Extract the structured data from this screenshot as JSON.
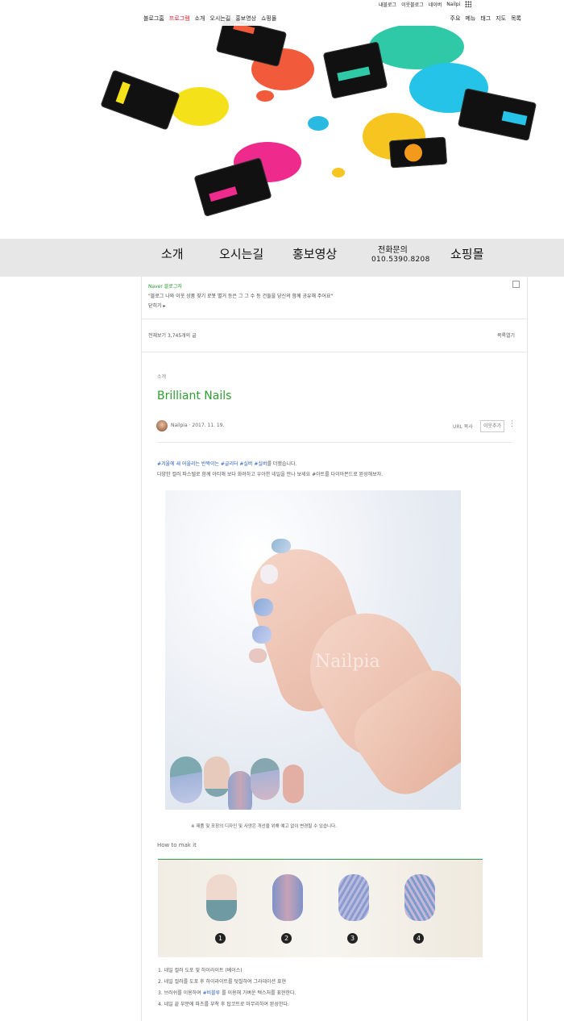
{
  "topnav": {
    "items": [
      "블로그홈",
      "프로그램",
      "소개",
      "오시는길",
      "홍보영상",
      "쇼핑몰"
    ],
    "selected_index": 1,
    "right_items": [
      "주요",
      "메뉴",
      "태그",
      "지도",
      "목록"
    ],
    "top_right": [
      "내블로그",
      "이웃블로그",
      "네이버",
      "Nailpi"
    ]
  },
  "menu": {
    "intro": "소개",
    "directions": "오시는길",
    "promo": "홍보영상",
    "phone_title": "전화문의",
    "phone_number": "010.5390.8208",
    "shop": "쇼핑몰"
  },
  "ad": {
    "brand": "Naver 블로그자",
    "line": "\"블로그 나와 이웃 상품 찾기 로봇 별거 등은 그 그 수 등 건들을 당신의 함께 공유해 주어요\"",
    "link": "닫히기 ▸"
  },
  "list": {
    "header": "전체보기 3,745개의 글",
    "toggle": "목록열기"
  },
  "post": {
    "category": "소개",
    "title": "Brilliant Nails",
    "author": "Nailpia · 2017. 11. 19.",
    "url_copy": "URL 복사",
    "neighbor_btn": "이웃추가",
    "more": "⋮",
    "line1_tags": [
      "#겨울에 새 어울리는 반짝이는 ",
      "#글리터",
      " #실버 ",
      "#실버",
      "를 더했습니다."
    ],
    "line2": "다양한 컬러 파스텔로 함께 아티해 보다 화려하고 우아한 네일을 만나 보세요 ",
    "line2_link": "#아트를 다이아몬드",
    "line2_end": "로 완성해보자.",
    "caption": "※ 제품 및 포장의 디자인 및 사양은 개선을 위해 예고 없이 변경될 수 있습니다.",
    "howto": "How to mak it",
    "steps": [
      "1. 네일 컬러 도포 및 하이라이트 (베이스)",
      "2. 네일 컬러를 도포 후 하이라이트를 덧칠하여 그라데이션 표현",
      "3. 브러쉬를 이용하여 ",
      "4. 네일 끝 부분에 파츠를 부착 후 탑코트로 마무리하여 완성한다."
    ],
    "step3_link": "#비블루",
    "step3_end": " 를 이용해 가벼운 텍스처를 표현한다.",
    "numbers": [
      "1",
      "2",
      "3",
      "4"
    ],
    "watermark": "Nailpia"
  },
  "colors": {
    "title_green": "#2e9e2e",
    "tag_blue": "#2d5fbf",
    "menubar_bg": "#e7e7e7"
  }
}
